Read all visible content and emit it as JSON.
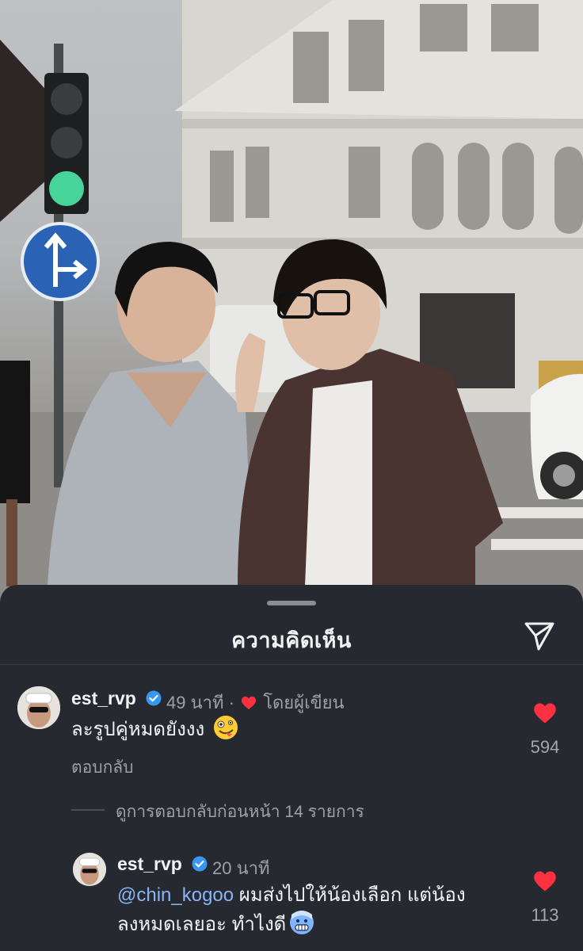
{
  "sheet": {
    "title": "ความคิดเห็น",
    "share_icon": "send-icon"
  },
  "comments": [
    {
      "username": "est_rvp",
      "verified": true,
      "time": "49 นาที",
      "separator": "·",
      "liked_by_author_label": "โดยผู้เขียน",
      "text": "ละรูปคู่หมดยังงง",
      "emoji": "zany-face",
      "reply_label": "ตอบกลับ",
      "likes": "594"
    }
  ],
  "view_previous_replies": "ดูการตอบกลับก่อนหน้า 14 รายการ",
  "replies": [
    {
      "username": "est_rvp",
      "verified": true,
      "time": "20 นาที",
      "mention": "@chin_kogoo",
      "text_line1": " ผมส่งไปให้น้องเลือก แต่น้อง",
      "text_line2": "ลงหมดเลยอะ ทำไงดี",
      "emoji": "freezing-face",
      "likes": "113"
    }
  ],
  "colors": {
    "sheet_bg": "#262a30",
    "like_red": "#ff3040",
    "verified_blue": "#3897f0",
    "mention_blue": "#8ab4f8"
  }
}
